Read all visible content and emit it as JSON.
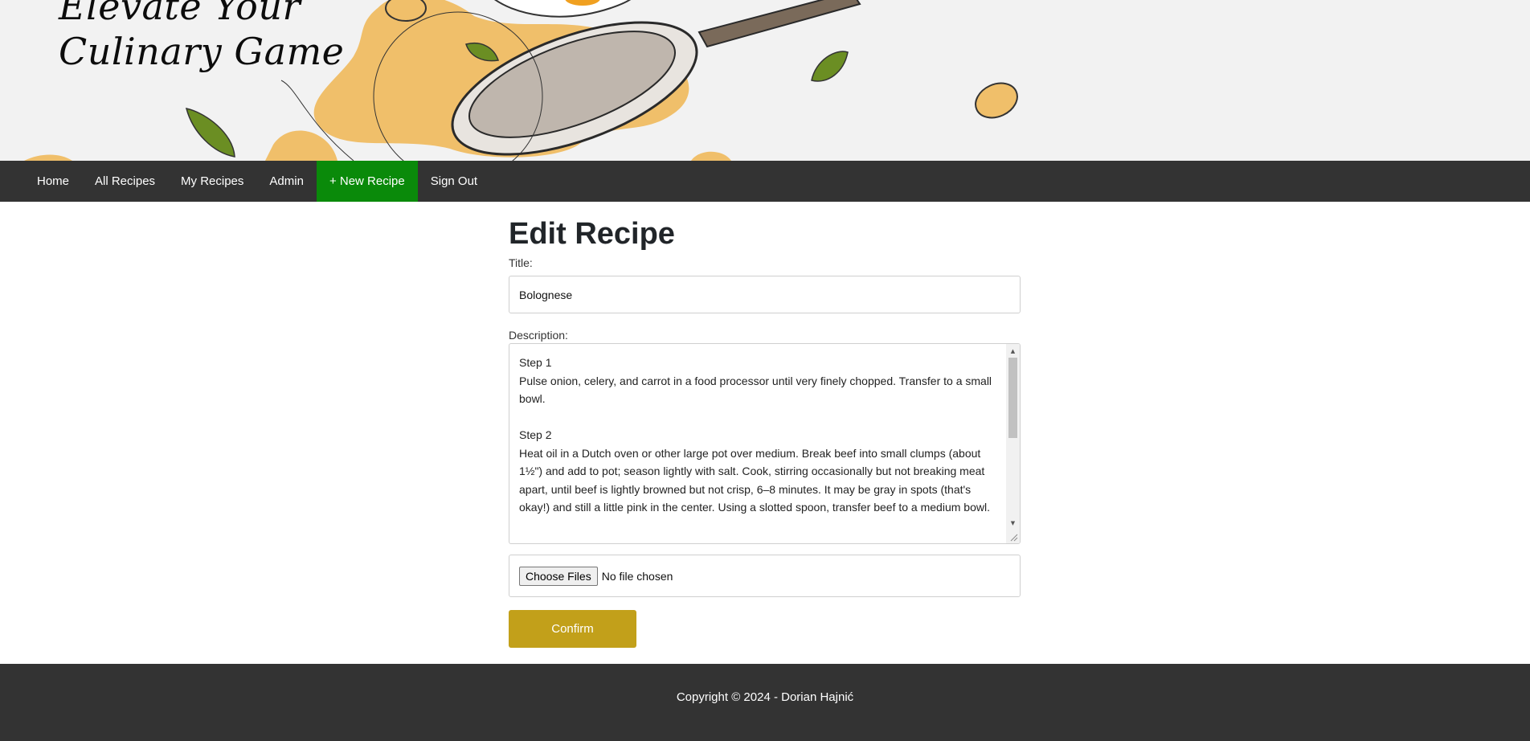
{
  "hero": {
    "tagline": "Elevate Your\nCulinary Game"
  },
  "nav": {
    "items": [
      {
        "label": "Home",
        "active": false
      },
      {
        "label": "All Recipes",
        "active": false
      },
      {
        "label": "My Recipes",
        "active": false
      },
      {
        "label": "Admin",
        "active": false
      },
      {
        "label": "+ New Recipe",
        "active": true
      },
      {
        "label": "Sign Out",
        "active": false
      }
    ],
    "active_color": "#0a8a0a",
    "background": "#333333"
  },
  "form": {
    "heading": "Edit Recipe",
    "title_label": "Title:",
    "title_value": "Bolognese",
    "description_label": "Description:",
    "description_value": "Step 1\nPulse onion, celery, and carrot in a food processor until very finely chopped. Transfer to a small bowl.\n\nStep 2\nHeat oil in a Dutch oven or other large pot over medium. Break beef into small clumps (about 1½\") and add to pot; season lightly with salt. Cook, stirring occasionally but not breaking meat apart, until beef is lightly browned but not crisp, 6–8 minutes. It may be gray in spots (that's okay!) and still a little pink in the center. Using a slotted spoon, transfer beef to a medium bowl.",
    "file_button": "Choose Files",
    "file_status": "No file chosen",
    "confirm_label": "Confirm",
    "confirm_color": "#c2a01a"
  },
  "footer": {
    "copyright": "Copyright © 2024 - Dorian Hajnić"
  }
}
